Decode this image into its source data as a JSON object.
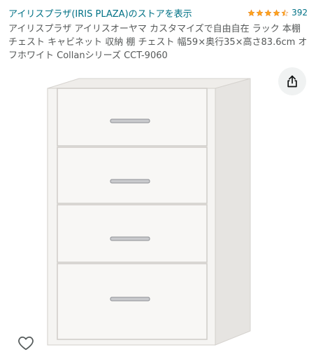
{
  "store": {
    "link_text": "アイリスプラザ(IRIS PLAZA)のストアを表示",
    "rating_stars": 4.5,
    "rating_count": "392"
  },
  "product": {
    "title": "アイリスプラザ アイリスオーヤマ カスタマイズで自由自在 ラック 本棚 チェスト キャビネット 収納 棚 チェスト 幅59×奥行35×高さ83.6cm オフホワイト Collanシリーズ CCT-9060",
    "drawer_count": 4
  },
  "colors": {
    "link": "#007185",
    "star": "#ffa41c",
    "text_secondary": "#565959",
    "share_bg": "#f0f2f2",
    "furniture": "#f5f4f2"
  },
  "icons": {
    "share": "share-icon",
    "wishlist": "heart-icon"
  }
}
